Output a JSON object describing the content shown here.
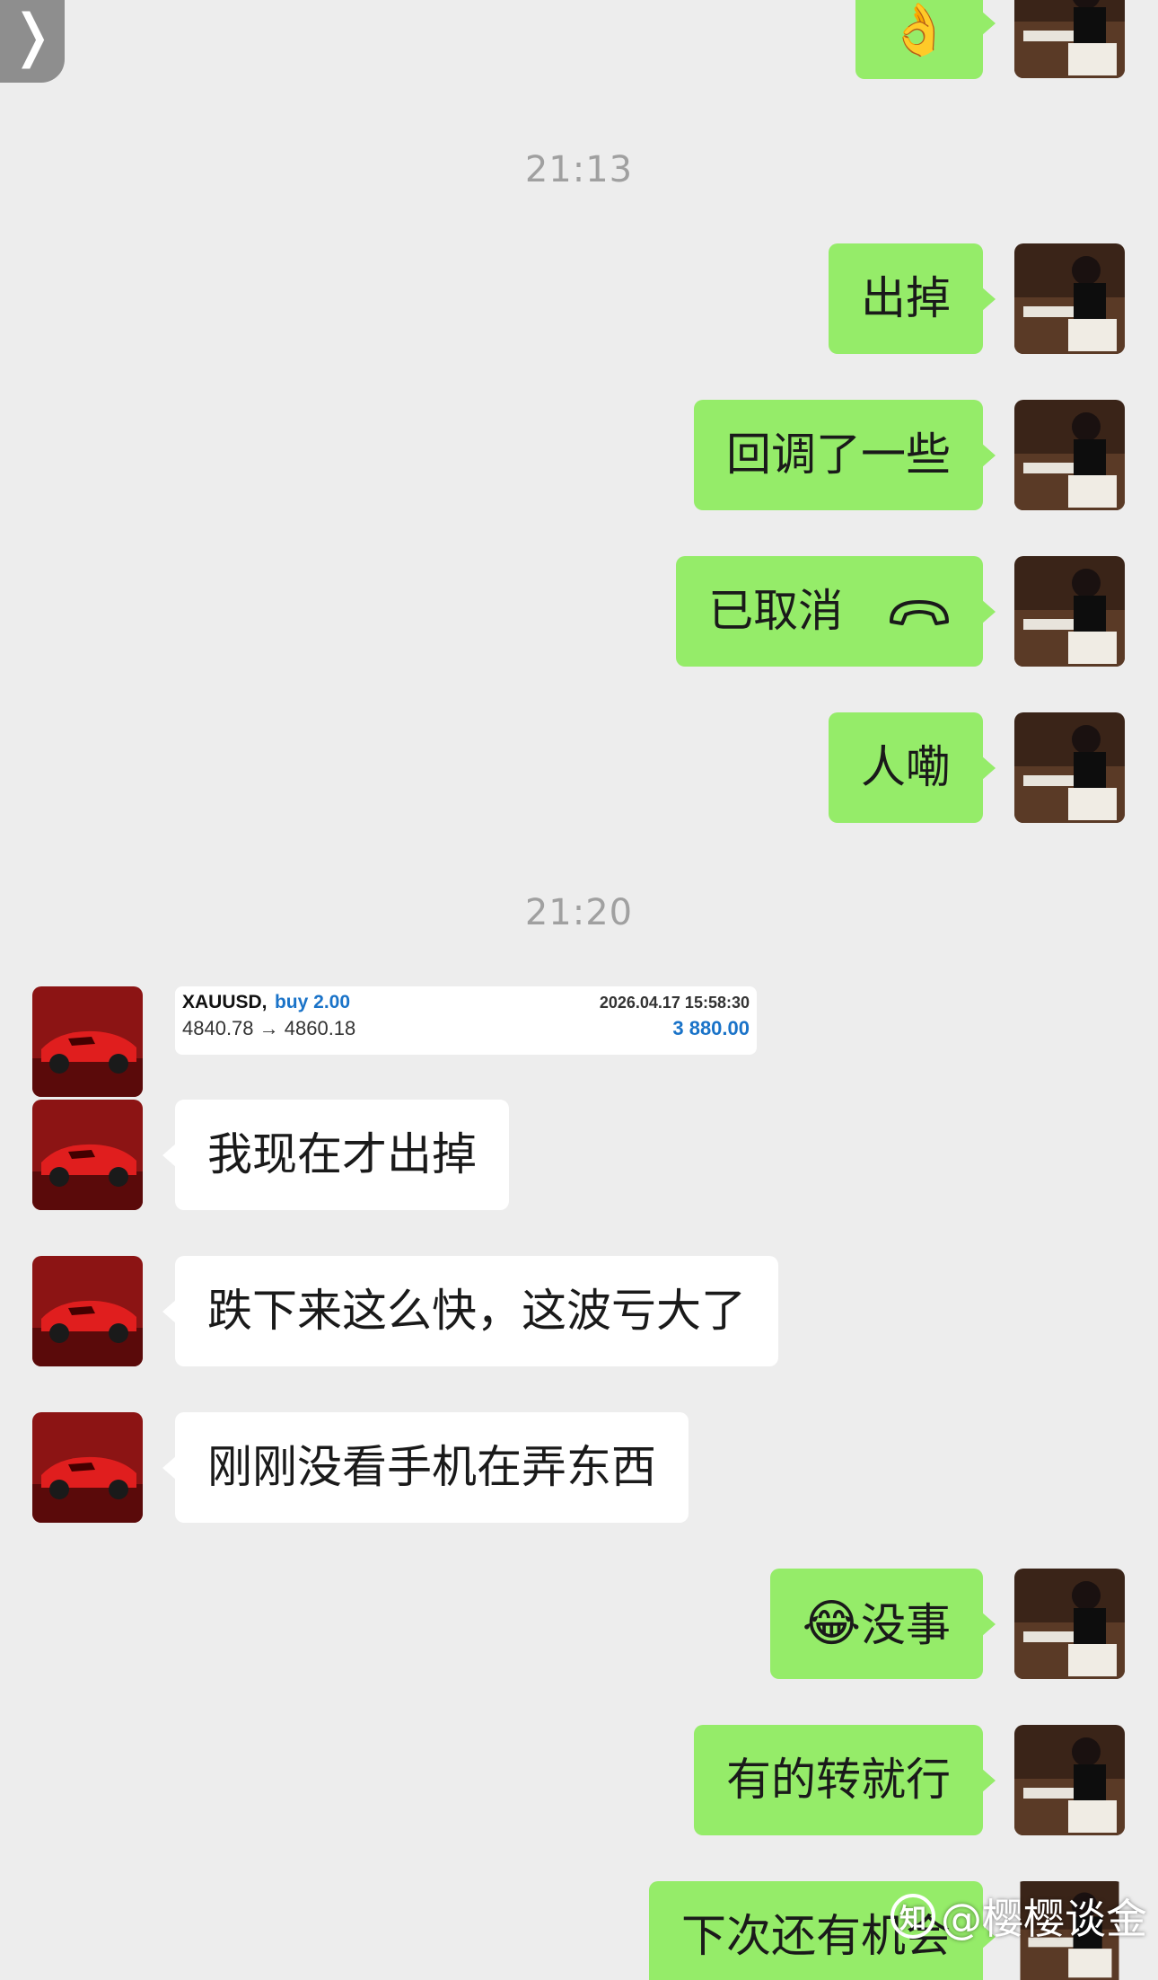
{
  "nav": {
    "back_glyph": "❭"
  },
  "timestamps": [
    "21:13",
    "21:20"
  ],
  "messages": [
    {
      "from": "self",
      "text": "👌"
    },
    {
      "from": "self",
      "text": "出掉"
    },
    {
      "from": "self",
      "text": "回调了一些"
    },
    {
      "from": "self",
      "text": "已取消"
    },
    {
      "from": "self",
      "text": "人嘞"
    },
    {
      "from": "other",
      "text": "我现在才出掉"
    },
    {
      "from": "other",
      "text": "跌下来这么快，这波亏大了"
    },
    {
      "from": "other",
      "text": "刚刚没看手机在弄东西"
    },
    {
      "from": "self",
      "emoji": "😂",
      "text": "没事"
    },
    {
      "from": "self",
      "text": "有的转就行"
    },
    {
      "from": "self",
      "text": "下次还有机会"
    }
  ],
  "trade_card": {
    "symbol": "XAUUSD,",
    "side": "buy 2.00",
    "datetime": "2026.04.17 15:58:30",
    "prices": "4840.78 → 4860.18",
    "profit": "3 880.00"
  },
  "colors": {
    "self_bubble": "#95ec69",
    "other_bubble": "#ffffff",
    "background": "#ededed",
    "trade_blue": "#1a73c8"
  },
  "watermark": {
    "logo": "知",
    "text": "@樱樱谈金"
  }
}
